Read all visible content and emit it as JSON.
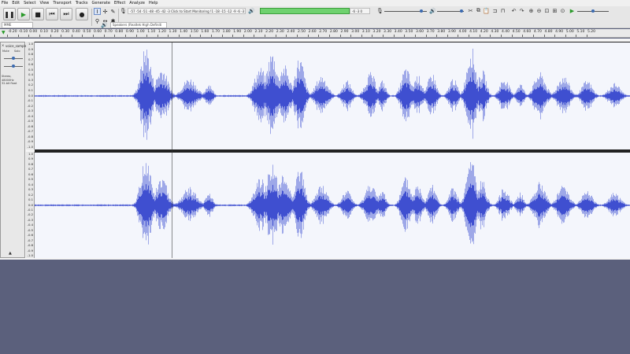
{
  "menu": [
    "File",
    "Edit",
    "Select",
    "View",
    "Transport",
    "Tracks",
    "Generate",
    "Effect",
    "Analyze",
    "Help"
  ],
  "transport": {
    "pause_icon": "pause-icon",
    "play_icon": "play-icon",
    "stop_icon": "stop-icon",
    "skip_start_icon": "skip-to-start-icon",
    "skip_end_icon": "skip-to-end-icon",
    "record_icon": "record-icon"
  },
  "meters": {
    "record_scale": "-57 -54 -51 -48 -45 -42 -3  Click to Start Monitoring  !1 -18 -15 -12  -9  -6  -3  0",
    "playback_scale": "-30 -27 -24 -21 -18 -15 -12  -9  -6  -3  0"
  },
  "devices": {
    "host": "MME",
    "output": "Speakers (Realtek High Definiti"
  },
  "ruler": {
    "ticks": [
      "-0.20",
      "-0.10",
      "0.00",
      "0.10",
      "0.20",
      "0.30",
      "0.40",
      "0.50",
      "0.60",
      "0.70",
      "0.80",
      "0.90",
      "1.00",
      "1.10",
      "1.20",
      "1.30",
      "1.40",
      "1.50",
      "1.60",
      "1.70",
      "1.80",
      "1.90",
      "2.00",
      "2.10",
      "2.20",
      "2.30",
      "2.40",
      "2.50",
      "2.60",
      "2.70",
      "2.80",
      "2.90",
      "3.00",
      "3.10",
      "3.20",
      "3.30",
      "3.40",
      "3.50",
      "3.60",
      "3.70",
      "3.80",
      "3.90",
      "4.00",
      "4.10",
      "4.20",
      "4.30",
      "4.40",
      "4.50",
      "4.60",
      "4.70",
      "4.80",
      "4.90",
      "5.00",
      "5.10",
      "5.20"
    ]
  },
  "track": {
    "name": "voice_sample",
    "mute_label": "Mute",
    "solo_label": "Solo",
    "info_line1": "Stereo, 48000Hz",
    "info_line2": "32-bit float",
    "gain": 0.5,
    "pan": 0.5
  },
  "scale_labels": [
    "1.0",
    "0.9",
    "0.8",
    "0.7",
    "0.6",
    "0.5",
    "0.4",
    "0.3",
    "0.2",
    "0.1",
    "0.0",
    "-0.1",
    "-0.2",
    "-0.3",
    "-0.4",
    "-0.5",
    "-0.6",
    "-0.7",
    "-0.8",
    "-0.9",
    "-1.0"
  ],
  "colors": {
    "wave": "#3f4fd0",
    "wave_light": "#9ea8e8",
    "background": "#5b607c"
  }
}
